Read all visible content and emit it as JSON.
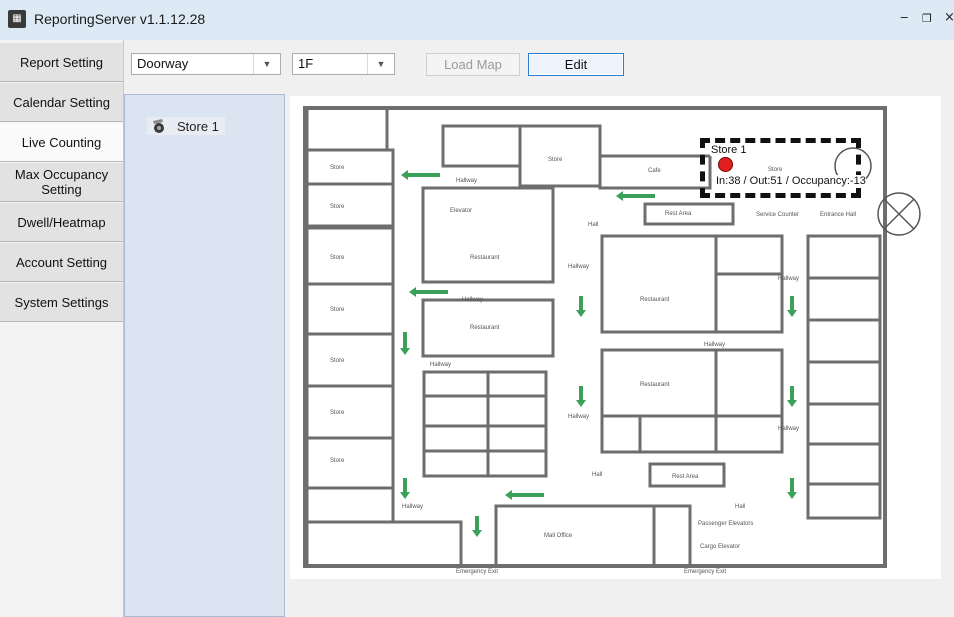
{
  "window": {
    "title": "ReportingServer v1.1.12.28"
  },
  "sidebar": {
    "tabs": [
      {
        "label": "Report Setting"
      },
      {
        "label": "Calendar Setting"
      },
      {
        "label": "Live Counting"
      },
      {
        "label": "Max Occupancy Setting"
      },
      {
        "label": "Dwell/Heatmap"
      },
      {
        "label": "Account Setting"
      },
      {
        "label": "System Settings"
      }
    ],
    "active_tab": "Live Counting"
  },
  "toolbar": {
    "type_select": {
      "value": "Doorway"
    },
    "floor_select": {
      "value": "1F"
    },
    "load_map_label": "Load Map",
    "edit_label": "Edit"
  },
  "tree": {
    "items": [
      {
        "label": "Store 1",
        "icon": "camera-icon"
      }
    ]
  },
  "map": {
    "sensor": {
      "name": "Store 1",
      "counts": "In:38 / Out:51 / Occupancy:-13",
      "status_color": "#e02020"
    },
    "labels": {
      "store": "Store",
      "cafe": "Cafe",
      "hallway": "Hallway",
      "elevator": "Elevator",
      "hall": "Hall",
      "restaurant": "Restaurant",
      "rest_area": "Rest Area",
      "service_counter": "Service Counter",
      "entrance_hall": "Entrance Hall",
      "mall_office": "Mall Office",
      "passenger_elevators": "Passenger Elevators",
      "cargo_elevator": "Cargo Elevator",
      "emergency_exit": "Emergency Exit"
    }
  },
  "colors": {
    "accent": "#2c7cd1",
    "tree_bg": "#dbe5f1",
    "arrow": "#3aa05a",
    "wall": "#6e6e6e"
  }
}
